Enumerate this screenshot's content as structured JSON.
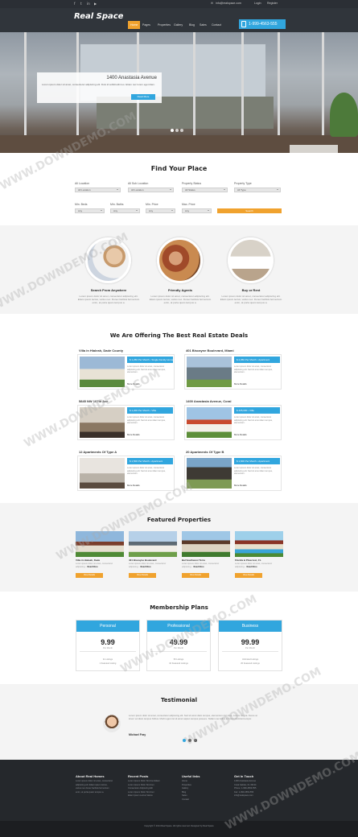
{
  "topbar": {
    "email": "info@realspace.com",
    "login": "Login",
    "register": "Register"
  },
  "header": {
    "logo": "Real Space",
    "menu": [
      "Home",
      "Pages",
      "Properties",
      "Gallery",
      "Blog",
      "Sales",
      "Contact"
    ],
    "phone": "1-999-4563-555"
  },
  "hero": {
    "caption_title": "1400 Anastasia Avenue",
    "caption_text": "Lorem ipsum dolor sit amet, consectetur adipiscing elit. Duis id sollicitudin leo. Etiam nec lorem eget diam.",
    "caption_button": "Read More"
  },
  "search": {
    "title": "Find Your Place",
    "fields": [
      {
        "label": "All Location",
        "value": "All Location"
      },
      {
        "label": "All Sub Location",
        "value": "All Location"
      },
      {
        "label": "Property Status",
        "value": "All Status"
      },
      {
        "label": "Property Type",
        "value": "All Type"
      },
      {
        "label": "Min. Beds",
        "value": "Any"
      },
      {
        "label": "Min. Baths",
        "value": "Any"
      },
      {
        "label": "Min. Price",
        "value": "Any"
      },
      {
        "label": "Max. Price",
        "value": "Any"
      }
    ],
    "button": "Search"
  },
  "features": [
    {
      "title": "Search From Anywhere",
      "text": "Lorem ipsum dolor sit amet, consectetur adipiscing elit. Etiam ipsum lectus, varius nec. Donec facilisis fermentum enim, at porta quam tempus a."
    },
    {
      "title": "Friendly Agents",
      "text": "Lorem ipsum dolor sit amet, consectetur adipiscing elit. Etiam ipsum lectus, varius nec. Donec facilisis fermentum enim, at porta quam tempus a."
    },
    {
      "title": "Buy or Rent",
      "text": "Lorem ipsum dolor sit amet, consectetur adipiscing elit. Etiam ipsum lectus, varius nec. Donec facilisis fermentum enim, at porta quam tempus a."
    }
  ],
  "deals": {
    "title": "We Are Offering The Best Real Estate Deals",
    "items": [
      {
        "title": "Villa in Hialeah, Dade County",
        "price": "$ 1,250 Per Month",
        "tag": "Single Family Home",
        "text": "Lorem ipsum dolor sit amet, consectetur adipiscing elit. Sed sit amet diam tempus, elementum.",
        "more": "More Details"
      },
      {
        "title": "401 Biscayne Boulevard, Miami",
        "price": "$ 2,050 Per Month",
        "tag": "Apartment",
        "text": "Lorem ipsum dolor sit amet, consectetur adipiscing elit. Sed sit amet diam tempus, elementum.",
        "more": "More Details"
      },
      {
        "title": "5845 NW 107th Ave",
        "price": "$ 1,200 Per Month",
        "tag": "Villa",
        "text": "Lorem ipsum dolor sit amet, consectetur adipiscing elit. Sed sit amet diam tempus, elementum.",
        "more": "More Details"
      },
      {
        "title": "1400 Anastasia Avenue, Coral",
        "price": "$ 435,000",
        "tag": "Villa",
        "text": "Lorem ipsum dolor sit amet, consectetur adipiscing elit. Sed sit amet diam tempus, elementum.",
        "more": "More Details"
      },
      {
        "title": "12 Apartments Of Type A",
        "price": "$ 1,500 Per Month",
        "tag": "Apartment",
        "text": "Lorem ipsum dolor sit amet, consectetur adipiscing elit. Sed sit amet diam tempus, elementum.",
        "more": "More Details"
      },
      {
        "title": "20 Apartments Of Type B",
        "price": "$ 1,600 Per Month",
        "tag": "Apartment",
        "text": "Lorem ipsum dolor sit amet, consectetur adipiscing elit. Sed sit amet diam tempus, elementum.",
        "more": "More Details"
      }
    ]
  },
  "featured": {
    "title": "Featured Properties",
    "items": [
      {
        "name": "Villa in Hialeah, Dade",
        "text": "Lorem ipsum dolor sit amet, consectetur adipiscing...",
        "more": "Read More",
        "button": "View Details"
      },
      {
        "name": "401 Biscayne Boulevard",
        "text": "Lorem ipsum dolor sit amet, consectetur adipiscing...",
        "more": "Read More",
        "button": "View Details"
      },
      {
        "name": "Bal Southwest Terra",
        "text": "Lorem ipsum dolor sit amet, consectetur adipiscing...",
        "more": "Read More",
        "button": "View Details"
      },
      {
        "name": "Florida & Pinecrest, FL",
        "text": "Lorem ipsum dolor sit amet, consectetur adipiscing...",
        "more": "Read More",
        "button": "View Details"
      }
    ]
  },
  "plans": {
    "title": "Membership Plans",
    "items": [
      {
        "name": "Personal",
        "price": "9.99",
        "per": "Per Month",
        "f1": "11 Listings",
        "f2": "1 Featured Listing"
      },
      {
        "name": "Professional",
        "price": "49.99",
        "per": "Per Month",
        "f1": "50 Listings",
        "f2": "10 Featured Listings"
      },
      {
        "name": "Business",
        "price": "99.99",
        "per": "Per Month",
        "f1": "Unlimited Listings",
        "f2": "20 Featured Listings"
      }
    ]
  },
  "testimonial": {
    "title": "Testimonial",
    "text": "Lorem ipsum dolor sit amet, consectetur adipiscing elit. Sed sit amet diam tempus, elementum nisl vitae, cursus magna. Fusce at lorem vel diam tempus finibus. Morbi eget nisi sit amet sapien tempus posuere. Nullam nec tellus ac lorem tincidunt tempor.",
    "author": "Michael Fray"
  },
  "footer": {
    "cols": [
      {
        "title": "About Real Homes",
        "links": [
          "Lorem ipsum dolor sit amet, consectetur",
          "adipiscing elit. Etiam ipsum lectus,",
          "varius nec donec facilisis fermentum",
          "enim, at porta quam tempus a."
        ]
      },
      {
        "title": "Recent Posts",
        "links": [
          "Lorem Ipsum Dolor Sit Amet Etiam",
          "Lorem Ipsum Dolor Sit Amet",
          "Consectetur Adipiscing Elit",
          "Lorem Ipsum Dolor Sit Amet",
          "Etiam Ipsum Lectus Varius"
        ]
      },
      {
        "title": "Useful links",
        "links": [
          "Home",
          "Properties",
          "Gallery",
          "Blog",
          "Sales",
          "Contact"
        ]
      },
      {
        "title": "Get In Touch",
        "links": [
          "1400 Anastasia Avenue",
          "Coral Gables, FL 33134",
          "Phone: 1-999-4563-555",
          "Fax: 1-999-4563-556",
          "info@realspace.com"
        ]
      }
    ],
    "copyright": "Copyright © 2014 Real Space. All rights reserved. Designed by Real Space"
  },
  "watermark": "WWW.DOWNDEMO.COM",
  "colors": {
    "accent_blue": "#31a6de",
    "accent_orange": "#f0a22e",
    "dark": "#30353b"
  }
}
